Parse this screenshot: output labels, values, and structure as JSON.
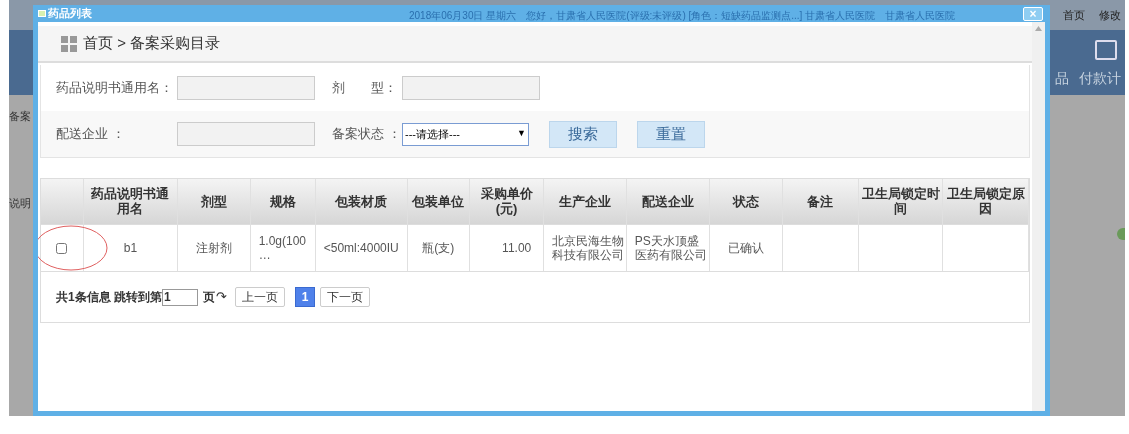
{
  "background_page": {
    "header_texts": [
      "2018年06月30日 星期六",
      "您好，甘肃省人民医院(评级:未评级) [角色：短缺药品监测点...] 甘肃省人民医院",
      "甘肃省人民医院"
    ],
    "top_links": [
      "首页",
      "修改"
    ],
    "nav_items": [
      "品",
      "付款计"
    ],
    "left_fragments": [
      "备案",
      "说明"
    ]
  },
  "dialog": {
    "title": "药品列表",
    "close": "×"
  },
  "breadcrumb": {
    "home": "首页",
    "separator": ">",
    "current": "备案采购目录"
  },
  "search_form": {
    "fields": [
      {
        "label": "药品说明书通用名：",
        "kind": "text"
      },
      {
        "label": "剂　　型：",
        "kind": "text"
      },
      {
        "label": "配送企业 ：",
        "kind": "text"
      },
      {
        "label": "备案状态 ：",
        "kind": "select",
        "value": "---请选择---",
        "arrow": "▼"
      }
    ],
    "buttons": [
      "搜索",
      "重置"
    ]
  },
  "table": {
    "columns": [
      "",
      "药品说明书通用名",
      "剂型",
      "规格",
      "包装材质",
      "包装单位",
      "采购单价(元)",
      "生产企业",
      "配送企业",
      "状态",
      "备注",
      "卫生局锁定时间",
      "卫生局锁定原因"
    ],
    "rows": [
      {
        "checked": false,
        "cells": [
          "",
          "b1",
          "注射剂",
          "1.0g(100 …",
          "<50ml:4000IU",
          "瓶(支)",
          "11.00",
          "北京民海生物科技有限公司",
          "PS天水顶盛医药有限公司",
          "已确认",
          "",
          "",
          ""
        ]
      }
    ]
  },
  "pagination": {
    "summary": "共1条信息 跳转到第",
    "page_input": "1",
    "page_suffix": "页",
    "go_icon": "↷",
    "prev": "上一页",
    "pages": [
      {
        "label": "1",
        "selected": true
      }
    ],
    "next": "下一页"
  }
}
